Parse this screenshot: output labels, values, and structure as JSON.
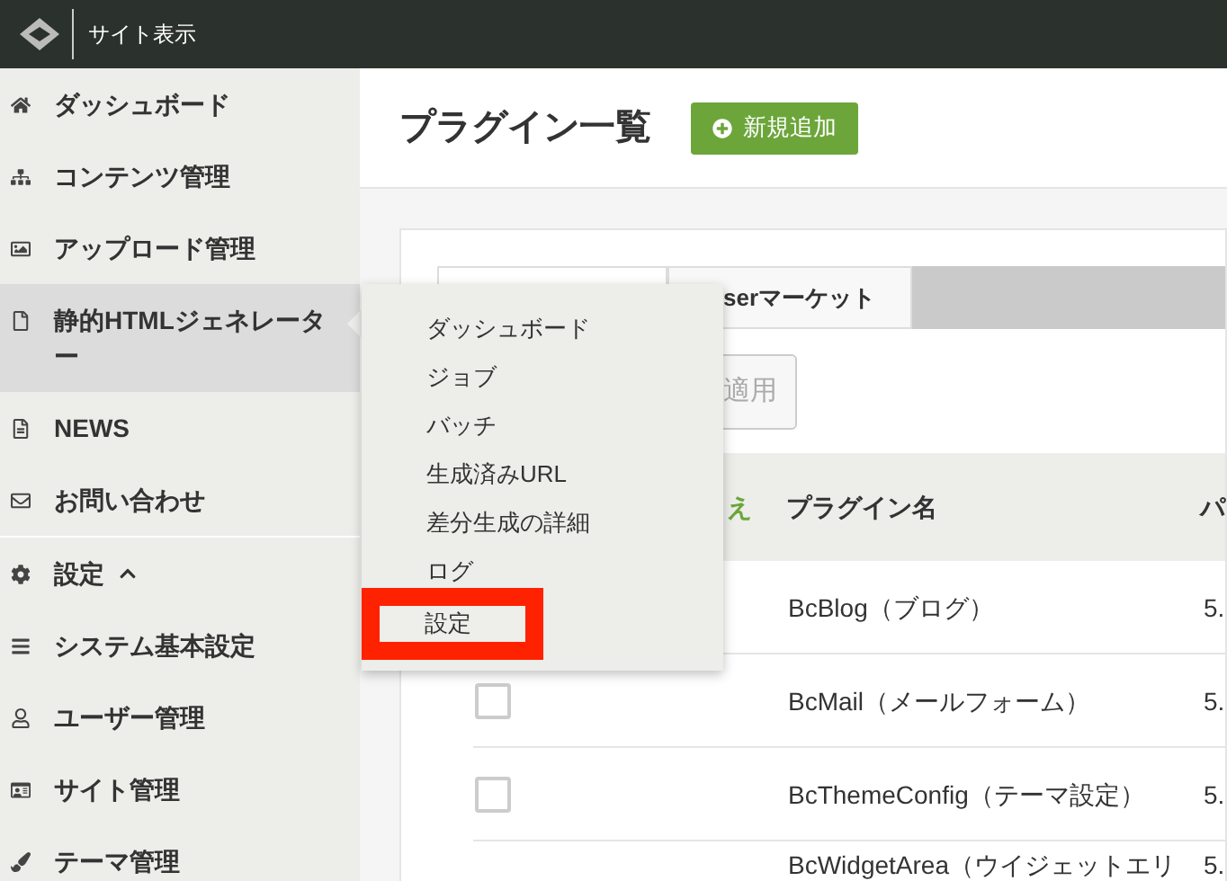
{
  "top_bar": {
    "site_link": "サイト表示"
  },
  "sidebar": {
    "groups": [
      [
        {
          "label": "ダッシュボード",
          "selected": false
        },
        {
          "label": "コンテンツ管理",
          "selected": false
        },
        {
          "label": "アップロード管理",
          "selected": false
        },
        {
          "label": "静的HTMLジェネレーター",
          "selected": true
        },
        {
          "label": "NEWS",
          "selected": false
        },
        {
          "label": "お問い合わせ",
          "selected": false
        }
      ],
      [
        {
          "label": "設定",
          "selected": false,
          "expanded": true
        },
        {
          "label": "システム基本設定",
          "selected": false
        },
        {
          "label": "ユーザー管理",
          "selected": false
        },
        {
          "label": "サイト管理",
          "selected": false
        },
        {
          "label": "テーマ管理",
          "selected": false
        }
      ]
    ]
  },
  "page": {
    "title": "プラグイン一覧",
    "add_button": "新規追加"
  },
  "tabs": [
    {
      "label": "serマーケット"
    }
  ],
  "apply_button": "適用",
  "table": {
    "columns": [
      "え",
      "プラグイン名",
      "パ"
    ],
    "rows": [
      {
        "name": "BcBlog（ブログ）",
        "version": "5."
      },
      {
        "checked": false,
        "name": "BcMail（メールフォーム）",
        "version": "5."
      },
      {
        "checked": false,
        "name": "BcThemeConfig（テーマ設定）",
        "version": "5."
      },
      {
        "name": "BcWidgetArea（ウイジェットエリ",
        "version": "5."
      }
    ]
  },
  "submenu": {
    "items": [
      {
        "label": "ダッシュボード",
        "highlighted": false
      },
      {
        "label": "ジョブ",
        "highlighted": false
      },
      {
        "label": "バッチ",
        "highlighted": false
      },
      {
        "label": "生成済みURL",
        "highlighted": false
      },
      {
        "label": "差分生成の詳細",
        "highlighted": false
      },
      {
        "label": "ログ",
        "highlighted": false
      },
      {
        "label": "設定",
        "highlighted": true
      }
    ]
  }
}
